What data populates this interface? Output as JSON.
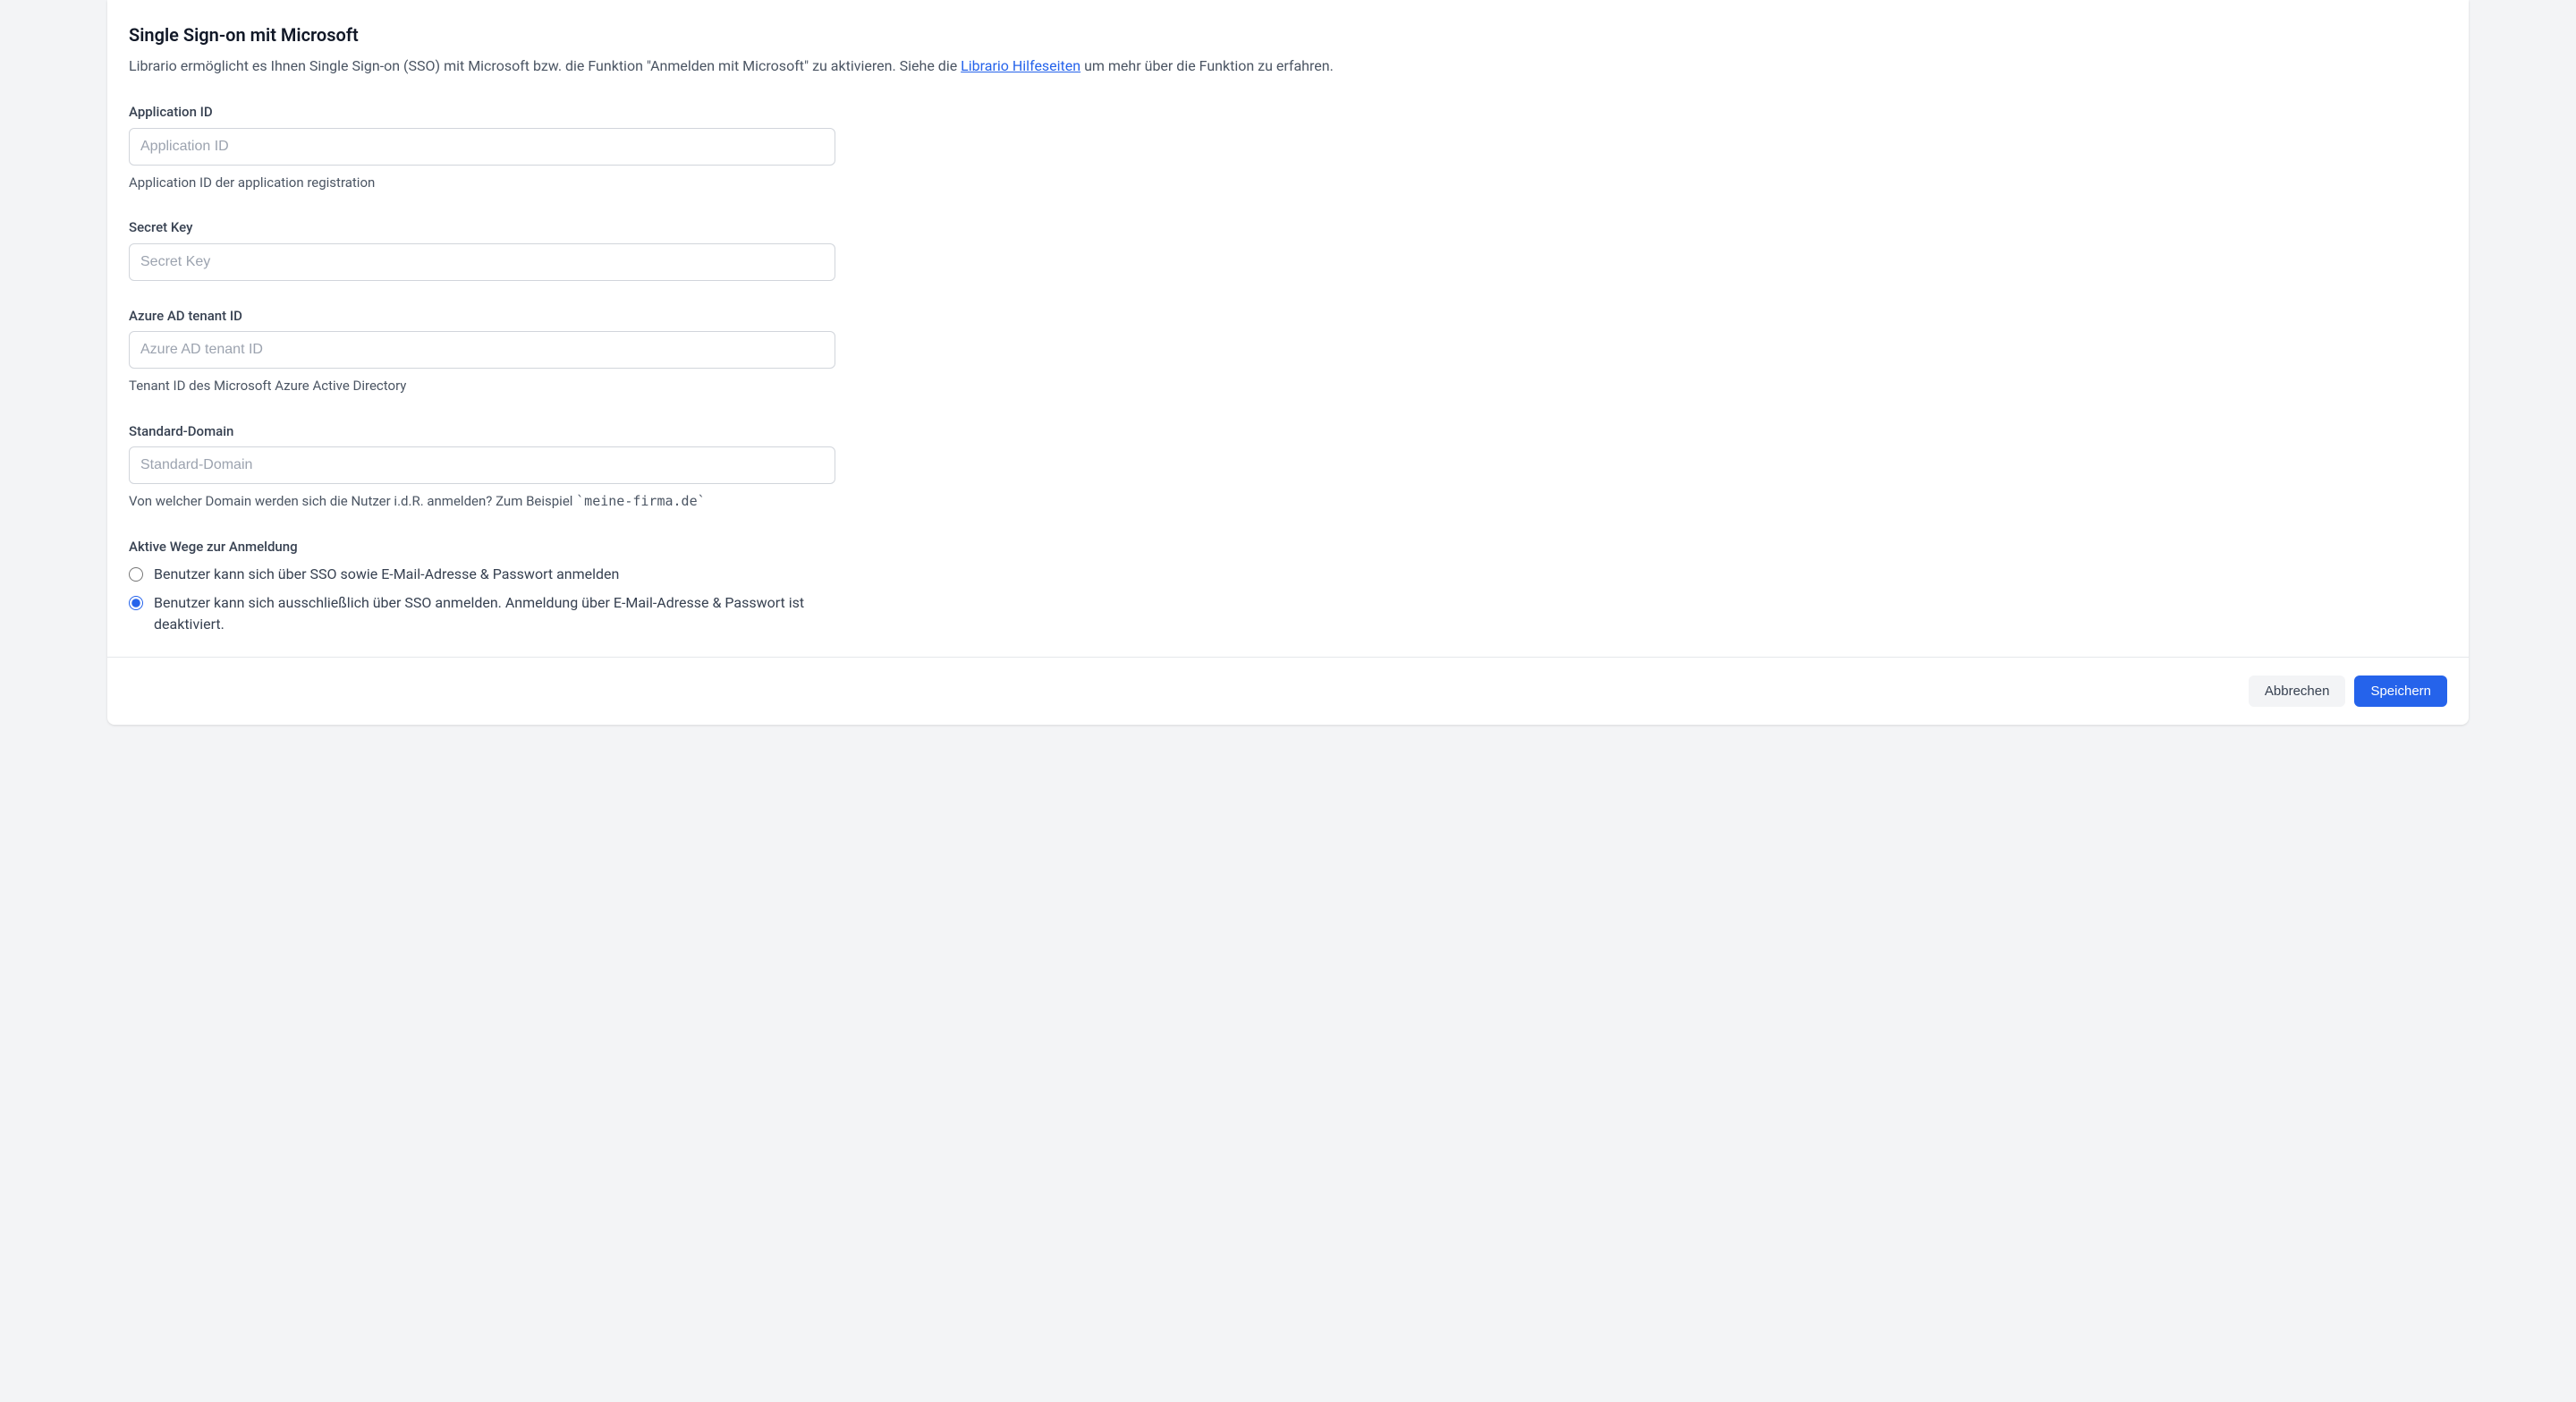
{
  "header": {
    "title": "Single Sign-on mit Microsoft",
    "intro_pre": "Librario ermöglicht es Ihnen Single Sign-on (SSO) mit Microsoft bzw. die Funktion \"Anmelden mit Microsoft\" zu aktivieren. Siehe die ",
    "intro_link": "Librario Hilfeseiten",
    "intro_post": " um mehr über die Funktion zu erfahren."
  },
  "fields": {
    "application_id": {
      "label": "Application ID",
      "placeholder": "Application ID",
      "value": "",
      "help": "Application ID der application registration"
    },
    "secret_key": {
      "label": "Secret Key",
      "placeholder": "Secret Key",
      "value": ""
    },
    "tenant_id": {
      "label": "Azure AD tenant ID",
      "placeholder": "Azure AD tenant ID",
      "value": "",
      "help": "Tenant ID des Microsoft Azure Active Directory"
    },
    "default_domain": {
      "label": "Standard-Domain",
      "placeholder": "Standard-Domain",
      "value": "",
      "help_pre": "Von welcher Domain werden sich die Nutzer i.d.R. anmelden? Zum Beispiel ",
      "help_code": "`meine-firma.de`"
    }
  },
  "login_methods": {
    "section_label": "Aktive Wege zur Anmeldung",
    "option_both": "Benutzer kann sich über SSO sowie E-Mail-Adresse & Passwort anmelden",
    "option_sso_only": "Benutzer kann sich ausschließlich über SSO anmelden. Anmeldung über E-Mail-Adresse & Passwort ist deaktiviert.",
    "selected": "sso_only"
  },
  "footer": {
    "cancel": "Abbrechen",
    "save": "Speichern"
  }
}
